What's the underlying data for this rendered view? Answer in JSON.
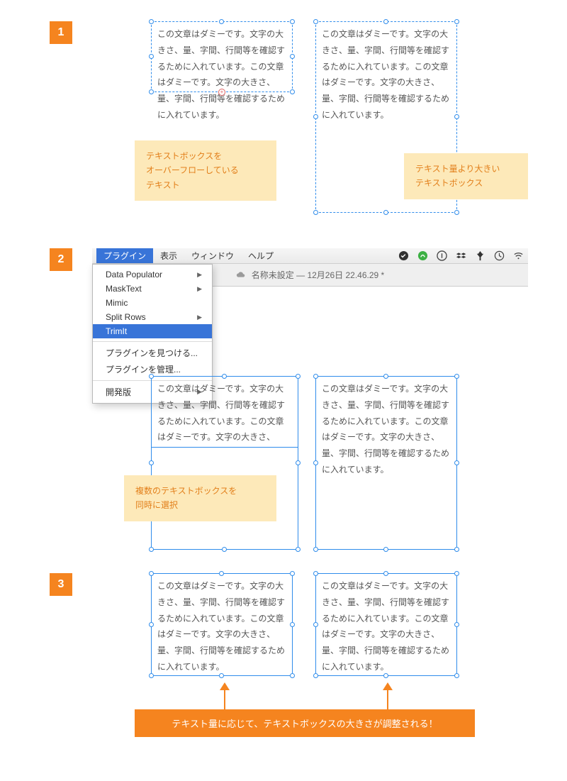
{
  "badges": {
    "one": "1",
    "two": "2",
    "three": "3"
  },
  "dummy_text": "この文章はダミーです。文字の大きさ、量、字間、行間等を確認するために入れています。この文章はダミーです。文字の大きさ、量、字間、行間等を確認するために入れています。",
  "note1_left": "テキストボックスを\nオーバーフローしている\nテキスト",
  "note1_right": "テキスト量より大きい\nテキストボックス",
  "note2": "複数のテキストボックスを\n同時に選択",
  "menubar": {
    "plugin": "プラグイン",
    "view": "表示",
    "window": "ウィンドウ",
    "help": "ヘルプ"
  },
  "titlebar": "名称未設定 — 12月26日 22.46.29 *",
  "dropdown": {
    "items": [
      "Data Populator",
      "MaskText",
      "Mimic",
      "Split Rows",
      "TrimIt"
    ],
    "find": "プラグインを見つける...",
    "manage": "プラグインを管理...",
    "dev": "開発版"
  },
  "banner": "テキスト量に応じて、テキストボックスの大きさが調整される！"
}
